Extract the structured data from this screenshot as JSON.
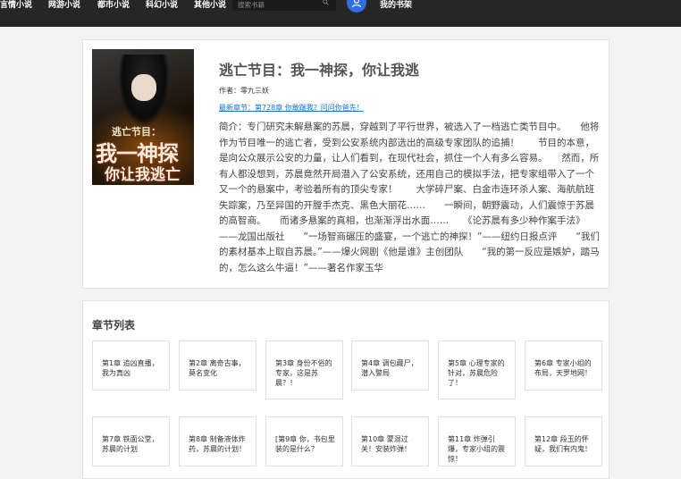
{
  "nav": {
    "items": [
      "言情小说",
      "网游小说",
      "都市小说",
      "科幻小说",
      "其他小说"
    ],
    "search_placeholder": "搜索书籍",
    "bookshelf_label": "我的书架"
  },
  "book": {
    "title": "逃亡节目：我一神探，你让我逃",
    "author": "作者：零九三妖",
    "latest": "最新章节：第728章 你敢踹我？问问你爸先！",
    "intro": "简介：专门研究未解悬案的苏晨，穿越到了平行世界，被选入了一档逃亡类节目中。　　他将作为节目唯一的逃亡者，受到公安系统内部选出的高级专家团队的追捕！　　节目的本意，是向公众展示公安的力量，让人们看到，在现代社会，抓住一个人有多么容易。　　然而，所有人都没想到，苏晨竟然开局潜入了公安系统，还用自己的模拟手法，把专家组带入了一个又一个的悬案中，考验着所有的顶尖专家！　　大学碎尸案、白金市连环杀人案、海航航班失踪案，乃至异国的开膛手杰克、黑色大丽花……　　一瞬间，朝野震动，人们震惊于苏晨的高智商。　　而诸多悬案的真相，也渐渐浮出水面……　　《论苏晨有多少种作案手法》——龙国出版社　　“一场智商碾压的盛宴，一个逃亡的神探！”——纽约日报点评　　“我们的素材基本上取自苏晨。”——爆火网剧《他是谁》主创团队　　“我的第一反应是嫉妒，踏马的，怎么这么牛逼！”——著名作家玉华",
    "cover": {
      "line1": "逃亡节目：",
      "line2": "我一神探",
      "line3": "你让我逃亡"
    }
  },
  "chapters": {
    "heading": "章节列表",
    "items": [
      "第1章 追凶直播，我为真凶",
      "第2章 离奇古事，莫名变化",
      "第3章 身份不俗的专家，这是苏晨？！",
      "第4章 调包藏尸，潜入警局",
      "第5章 心理专家的针对，苏晨危险了！",
      "第6章 专家小组的布局，天罗地网！",
      "第7章 铁面公堂，苏晨的计划",
      "第8章 制备液体炸药，苏晨的计划！",
      "[第9章 你，书包里装的是什么？",
      "第10章 蒙混过关！安装炸弹！",
      "第11章 炸弹引爆，专家小组的震惊！",
      "第12章 段玉的怀疑，我们有内鬼！"
    ]
  },
  "colors": {
    "topbar": "#262626",
    "accent": "#2f6ee5",
    "link": "#1a6fd6"
  }
}
